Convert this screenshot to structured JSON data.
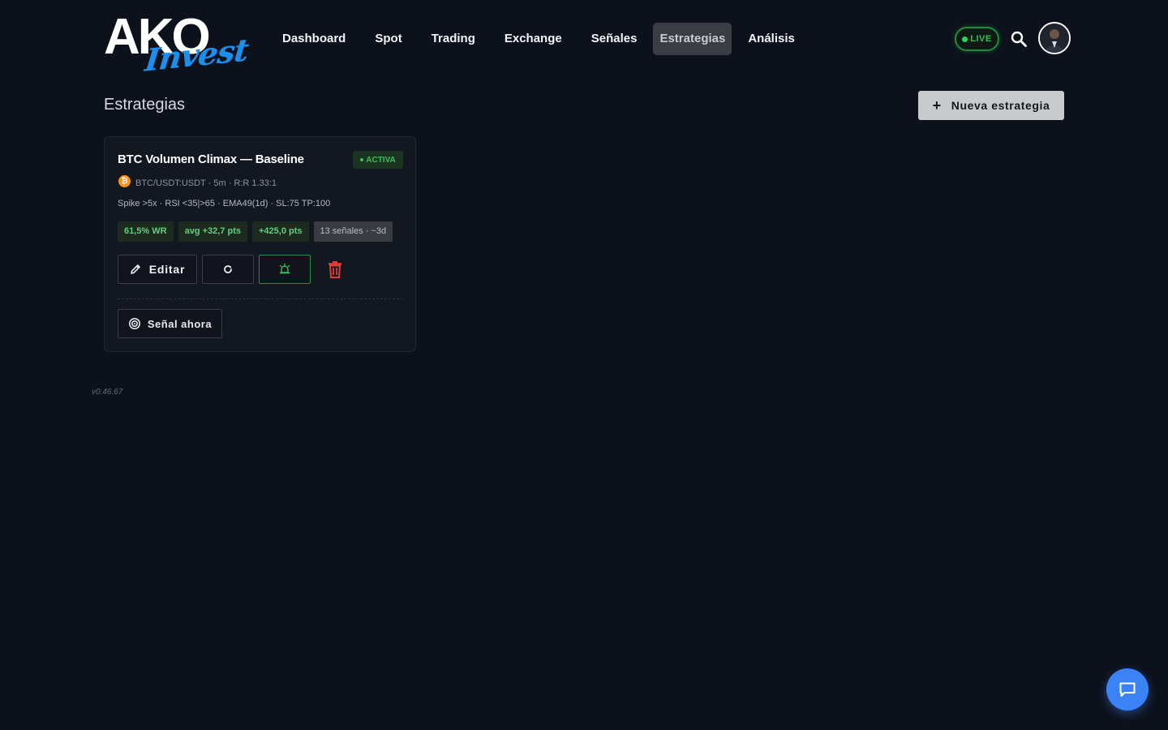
{
  "brand": {
    "primary": "AKO",
    "secondary": "Invest",
    "accent": "#1e8fe8"
  },
  "nav": {
    "items": [
      {
        "label": "Dashboard",
        "active": false
      },
      {
        "label": "Spot",
        "active": false
      },
      {
        "label": "Trading",
        "active": false
      },
      {
        "label": "Exchange",
        "active": false
      },
      {
        "label": "Señales",
        "active": false
      },
      {
        "label": "Estrategias",
        "active": true
      },
      {
        "label": "Análisis",
        "active": false
      }
    ]
  },
  "header": {
    "live_label": "LIVE",
    "live_color": "#2fc35a",
    "search_icon": "search-icon",
    "avatar_icon": "user-avatar"
  },
  "page": {
    "title": "Estrategias",
    "new_button_label": "Nueva estrategia",
    "new_button_icon": "plus-icon"
  },
  "strategy": {
    "title": "BTC Volumen Climax — Baseline",
    "status": "ACTIVA",
    "status_color": "#35c25a",
    "coin_icon": "bitcoin-icon",
    "coin_symbol": "₿",
    "meta": "BTC/USDT:USDT · 5m · R:R 1.33:1",
    "rules": "Spike >5x · RSI <35|>65 · EMA49(1d) · SL:75 TP:100",
    "chips": {
      "win_rate": "61,5% WR",
      "avg": "avg +32,7 pts",
      "total": "+425,0 pts",
      "signals": "13 señales · ~3d"
    },
    "actions": {
      "edit_label": "Editar",
      "refresh_icon": "refresh-icon",
      "alarm_icon": "alarm-icon",
      "delete_icon": "trash-icon",
      "delete_color": "#e53935"
    },
    "signal_label": "Señal ahora",
    "signal_icon": "target-icon"
  },
  "footer": {
    "version": "v0.46.67"
  },
  "chat": {
    "icon": "chat-icon",
    "color": "#3b82f6"
  }
}
